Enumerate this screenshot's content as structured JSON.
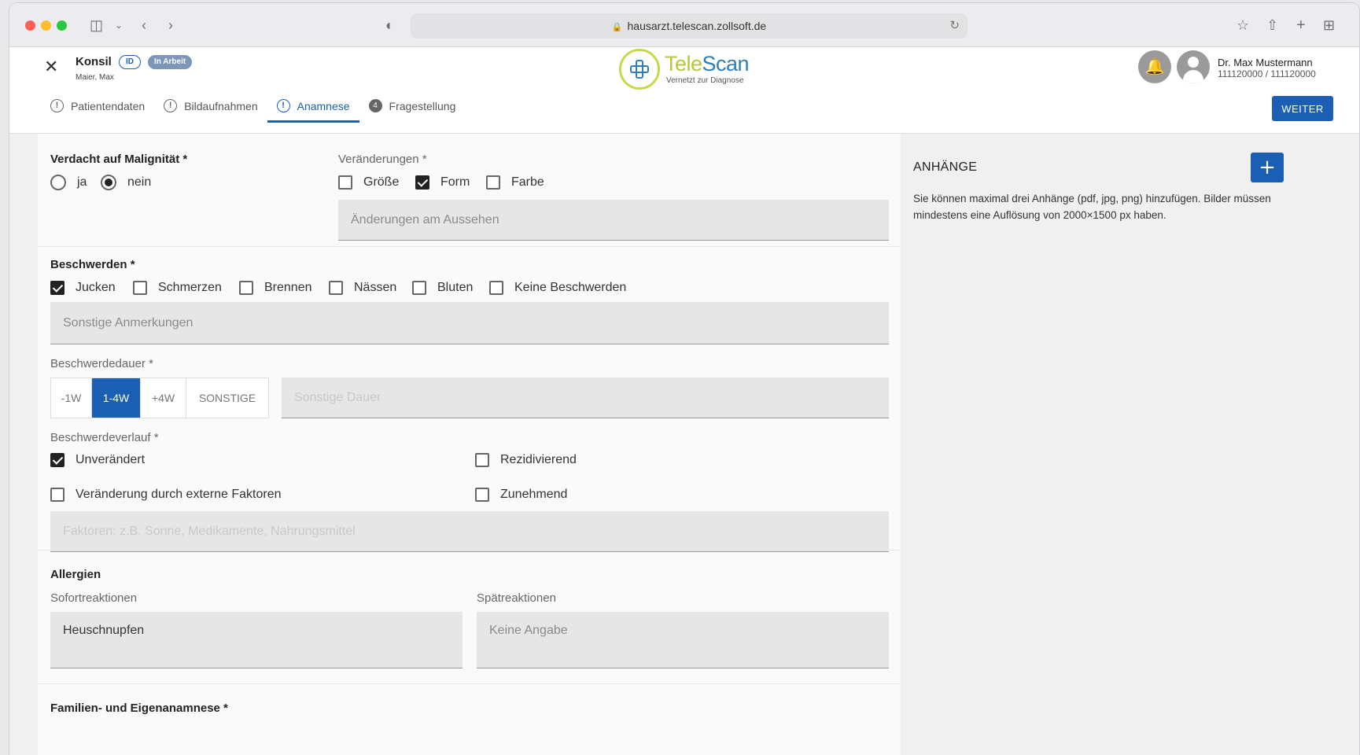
{
  "browser": {
    "url": "hausarzt.telescan.zollsoft.de"
  },
  "header": {
    "title": "Konsil",
    "id_badge": "ID",
    "status_badge": "In Arbeit",
    "patient": "Maier, Max",
    "logo_tele": "Tele",
    "logo_scan": "Scan",
    "logo_tagline": "Vernetzt zur Diagnose",
    "user_name": "Dr. Max Mustermann",
    "user_ids": "111120000 / 111120000",
    "next_button": "WEITER"
  },
  "tabs": [
    {
      "label": "Patientendaten",
      "icon": "!"
    },
    {
      "label": "Bildaufnahmen",
      "icon": "!"
    },
    {
      "label": "Anamnese",
      "icon": "!"
    },
    {
      "label": "Fragestellung",
      "icon": "4"
    }
  ],
  "malignancy": {
    "title": "Verdacht auf Malignität *",
    "options": [
      "ja",
      "nein"
    ],
    "selected": "nein"
  },
  "changes": {
    "label": "Veränderungen *",
    "options": [
      {
        "label": "Größe",
        "checked": false
      },
      {
        "label": "Form",
        "checked": true
      },
      {
        "label": "Farbe",
        "checked": false
      }
    ],
    "placeholder": "Änderungen am Aussehen"
  },
  "complaints": {
    "title": "Beschwerden *",
    "options": [
      {
        "label": "Jucken",
        "checked": true
      },
      {
        "label": "Schmerzen",
        "checked": false
      },
      {
        "label": "Brennen",
        "checked": false
      },
      {
        "label": "Nässen",
        "checked": false
      },
      {
        "label": "Bluten",
        "checked": false
      },
      {
        "label": "Keine Beschwerden",
        "checked": false
      }
    ],
    "placeholder": "Sonstige Anmerkungen"
  },
  "duration": {
    "label": "Beschwerdedauer *",
    "options": [
      "-1W",
      "1-4W",
      "+4W",
      "SONSTIGE"
    ],
    "selected": "1-4W",
    "placeholder": "Sonstige Dauer"
  },
  "course": {
    "label": "Beschwerdeverlauf *",
    "options": [
      {
        "label": "Unverändert",
        "checked": true
      },
      {
        "label": "Rezidivierend",
        "checked": false
      },
      {
        "label": "Veränderung durch externe Faktoren",
        "checked": false
      },
      {
        "label": "Zunehmend",
        "checked": false
      }
    ],
    "placeholder": "Faktoren: z.B. Sonne, Medikamente, Nahrungsmittel"
  },
  "allergies": {
    "title": "Allergien",
    "immediate_label": "Sofortreaktionen",
    "immediate_value": "Heuschnupfen",
    "delayed_label": "Spätreaktionen",
    "delayed_placeholder": "Keine Angabe"
  },
  "family": {
    "title": "Familien- und Eigenanamnese *"
  },
  "attachments": {
    "title": "ANHÄNGE",
    "add_label": "+",
    "info": "Sie können maximal drei Anhänge (pdf, jpg, png) hinzufügen. Bilder müssen mindestens eine Auflösung von 2000×1500 px haben."
  }
}
